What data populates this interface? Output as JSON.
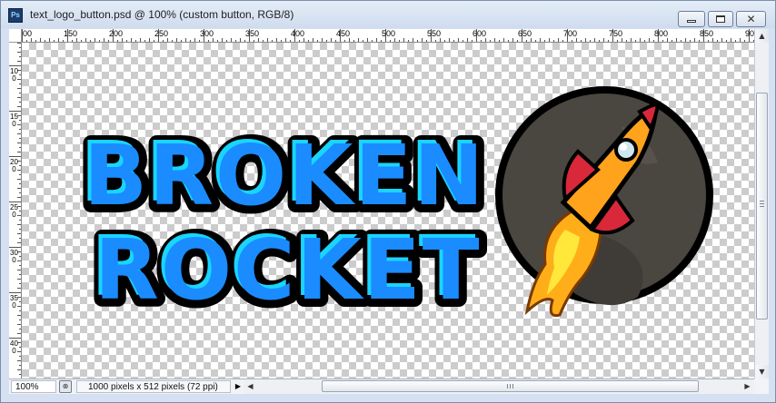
{
  "window": {
    "app_icon": "photoshop-icon",
    "app_icon_text": "Ps",
    "title": "text_logo_button.psd @ 100% (custom button, RGB/8)",
    "controls": {
      "minimize": "minimize-icon",
      "maximize": "maximize-icon",
      "close_glyph": "✕"
    }
  },
  "ruler_h": {
    "labels": [
      "00",
      "150",
      "200",
      "250",
      "300",
      "350",
      "400",
      "450",
      "500",
      "550",
      "600",
      "650",
      "700",
      "750",
      "800",
      "850",
      "90"
    ]
  },
  "ruler_v": {
    "labels": [
      "100",
      "150",
      "200",
      "250",
      "300",
      "350",
      "400"
    ]
  },
  "canvas": {
    "background": "transparency-checkerboard",
    "logo": {
      "line1": "BROKEN",
      "line2": "ROCKET",
      "text_color": "#1a8cff",
      "highlight_color": "#19d5ff",
      "outline_color": "#000000",
      "planet_color": "#4a4640",
      "rocket_body_color": "#ffa21c",
      "rocket_fin_color": "#d8283a",
      "flame_color": "#ffd41a"
    }
  },
  "status": {
    "zoom": "100%",
    "document_info": "1000 pixels x 512 pixels (72 ppi)",
    "menu_arrow": "▶",
    "scroll_left": "◀",
    "scroll_right": "▶",
    "scroll_up": "▲",
    "scroll_down": "▼"
  }
}
